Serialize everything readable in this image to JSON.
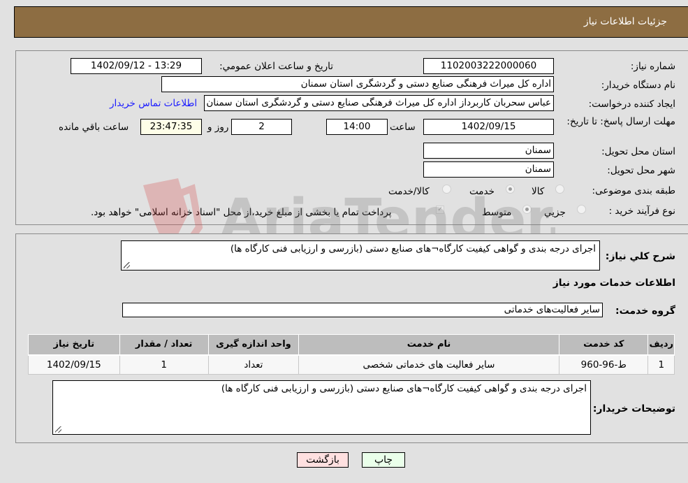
{
  "header": {
    "title": "جزئیات اطلاعات نیاز"
  },
  "form": {
    "need_number_label": "شماره نیاز:",
    "need_number": "1102003222000060",
    "announce_label": "تاریخ و ساعت اعلان عمومي:",
    "announce_value": "1402/09/12 - 13:29",
    "buyer_org_label": "نام دستگاه خریدار:",
    "buyer_org": "اداره کل میراث فرهنگی  صنایع دستی و گردشگری استان سمنان",
    "requester_label": "ایجاد کننده درخواست:",
    "requester": "عباس سحربان کاربرداز اداره کل میراث فرهنگی  صنایع دستی و گردشگری استان سمنان",
    "contact_link": "اطلاعات تماس خریدار",
    "deadline_label": "مهلت ارسال پاسخ: تا تاریخ:",
    "deadline_date": "1402/09/15",
    "time_label": "ساعت",
    "deadline_time": "14:00",
    "days_value": "2",
    "days_label": "روز و",
    "remaining_time": "23:47:35",
    "remaining_label": "ساعت باقي مانده",
    "province_label": "استان محل تحویل:",
    "province": "سمنان",
    "city_label": "شهر محل تحویل:",
    "city": "سمنان",
    "category_label": "طبقه بندی موضوعی:",
    "category_options": [
      {
        "label": "کالا",
        "checked": false
      },
      {
        "label": "خدمت",
        "checked": true
      },
      {
        "label": "کالا/خدمت",
        "checked": false
      }
    ],
    "purchase_type_label": "نوع فرآیند خرید :",
    "purchase_type_options": [
      {
        "label": "جزيي",
        "checked": false
      },
      {
        "label": "متوسط",
        "checked": true
      }
    ],
    "treasury_checkbox_label": "پرداخت تمام یا بخشی از مبلغ خرید،از محل \"اسناد خزانه اسلامی\" خواهد بود.",
    "treasury_checked": true
  },
  "details": {
    "general_desc_label": "شرح كلي نياز:",
    "general_desc": "اجرای درجه بندی و گواهی کیفیت کارگاه¬های صنایع دستی (بازرسی و ارزیابی فنی کارگاه ها)",
    "services_heading": "اطلاعات خدمات مورد نیاز",
    "service_group_label": "گروه خدمت:",
    "service_group": "سایر فعالیت‌های خدماتی",
    "table": {
      "headers": [
        "ردیف",
        "کد خدمت",
        "نام خدمت",
        "واحد اندازه گیری",
        "تعداد / مقدار",
        "تاریخ نیاز"
      ],
      "rows": [
        [
          "1",
          "ط-96-960",
          "سایر فعالیت های خدماتی شخصی",
          "تعداد",
          "1",
          "1402/09/15"
        ]
      ]
    },
    "buyer_notes_label": "توضیحات خریدار:",
    "buyer_notes": "اجرای درجه بندی و گواهی کیفیت کارگاه¬های صنایع دستی (بازرسی و ارزیابی فنی کارگاه ها)"
  },
  "buttons": {
    "print": "چاپ",
    "back": "بازگشت"
  },
  "watermark": {
    "text": "AriaTender.neT"
  },
  "colors": {
    "header_bg": "#8d6d42",
    "page_bg": "#e1e1e1",
    "link": "#1a1aff",
    "back_button_bg": "#ffe0e0",
    "print_button_bg": "#eaffea",
    "remaining_bg": "#fefee8"
  }
}
